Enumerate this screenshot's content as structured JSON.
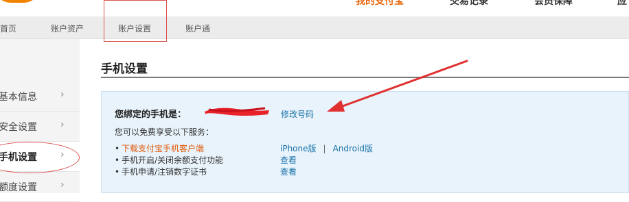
{
  "header": {
    "nav": [
      {
        "label": "我的支付宝",
        "active": true
      },
      {
        "label": "交易记录",
        "active": false
      },
      {
        "label": "会员保障",
        "active": false
      },
      {
        "label": "应",
        "active": false
      }
    ]
  },
  "subnav": {
    "items": [
      "首页",
      "账户资产",
      "账户设置",
      "账户通"
    ],
    "highlighted": "账户设置"
  },
  "sidebar": {
    "items": [
      {
        "label": "基本信息",
        "active": false
      },
      {
        "label": "安全设置",
        "active": false
      },
      {
        "label": "手机设置",
        "active": true
      },
      {
        "label": "额度设置",
        "active": false
      }
    ]
  },
  "main": {
    "title": "手机设置",
    "bound_label": "您绑定的手机是：",
    "modify_link": "修改号码",
    "intro": "您可以免费享受以下服务：",
    "services": [
      {
        "label": "下载支付宝手机客户端",
        "actions": [
          "iPhone版",
          "Android版"
        ],
        "separator": "|",
        "highlight": true
      },
      {
        "label": "手机开启/关闭余额支付功能",
        "actions": [
          "查看"
        ],
        "highlight": false
      },
      {
        "label": "手机申请/注销数字证书",
        "actions": [
          "查看"
        ],
        "highlight": false
      }
    ],
    "bullet": "•"
  },
  "colors": {
    "accent_orange": "#e8650a",
    "link_blue": "#1a73a8",
    "annotation_red": "#e03030",
    "panel_bg": "#e8f3fb"
  }
}
